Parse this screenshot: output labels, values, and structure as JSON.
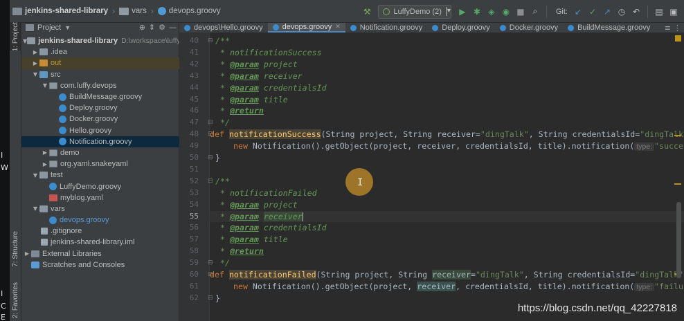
{
  "desktop_strip": {
    "glyphs": [
      "I",
      "W",
      "I",
      "C",
      "E"
    ]
  },
  "breadcrumb": {
    "project": "jenkins-shared-library",
    "folder": "vars",
    "file": "devops.groovy"
  },
  "run_config": {
    "label": "LuffyDemo (2)"
  },
  "vcs": {
    "label": "Git:"
  },
  "tool_windows": {
    "project": "1: Project",
    "structure": "7: Structure",
    "favorites": "2: Favorites"
  },
  "project_panel": {
    "title": "Project",
    "tree": [
      {
        "label": "jenkins-shared-library",
        "path": "D:\\workspace\\luffy\\je"
      },
      {
        "label": ".idea"
      },
      {
        "label": "out"
      },
      {
        "label": "src"
      },
      {
        "label": "com.luffy.devops"
      },
      {
        "label": "BuildMessage.groovy"
      },
      {
        "label": "Deploy.groovy"
      },
      {
        "label": "Docker.groovy"
      },
      {
        "label": "Hello.groovy"
      },
      {
        "label": "Notification.groovy"
      },
      {
        "label": "demo"
      },
      {
        "label": "org.yaml.snakeyaml"
      },
      {
        "label": "test"
      },
      {
        "label": "LuffyDemo.groovy"
      },
      {
        "label": "myblog.yaml"
      },
      {
        "label": "vars"
      },
      {
        "label": "devops.groovy"
      },
      {
        "label": ".gitignore"
      },
      {
        "label": "jenkins-shared-library.iml"
      },
      {
        "label": "External Libraries"
      },
      {
        "label": "Scratches and Consoles"
      }
    ]
  },
  "tabs": [
    {
      "label": "devops\\Hello.groovy"
    },
    {
      "label": "devops.groovy"
    },
    {
      "label": "Notification.groovy"
    },
    {
      "label": "Deploy.groovy"
    },
    {
      "label": "Docker.groovy"
    },
    {
      "label": "BuildMessage.groovy"
    }
  ],
  "editor": {
    "line_numbers": [
      "40",
      "41",
      "42",
      "43",
      "44",
      "45",
      "46",
      "47",
      "48",
      "49",
      "50",
      "51",
      "52",
      "53",
      "54",
      "55",
      "56",
      "57",
      "58",
      "59",
      "60",
      "61",
      "62"
    ],
    "current_line": "55",
    "code": {
      "l40": "/**",
      "l41": " * notificationSuccess",
      "at_param": "@param",
      "at_return": "@return",
      "star": " * ",
      "p_project": " project",
      "p_receiver": " receiver",
      "p_credentials": " credentialsId",
      "p_title": " title",
      "l47": " */",
      "kw_def": "def",
      "fn_success": "notificationSuccess",
      "sig_success": "(String project, String receiver=",
      "str_ding": "\"dingTalk\"",
      "sig_mid": ", String credentialsId=",
      "sig_end": ", ",
      "kw_new": "new",
      "call_body": " Notification().getObject(project, receiver, credentialsId, title).notification(",
      "hint_type": "type:",
      "str_success": "\"success\"",
      "close_brace": "}",
      "l53": " * notificationFailed",
      "fn_failed": "notificationFailed",
      "sig_failed_1": "(String project, String ",
      "receiver_word": "receiver",
      "sig_failed_2": "=",
      "call_body_1": " Notification().getObject(project, ",
      "call_body_2": ", credentialsId, title).notification(",
      "str_failure": "\"failure"
    }
  },
  "watermark": "https://blog.csdn.net/qq_42227818"
}
